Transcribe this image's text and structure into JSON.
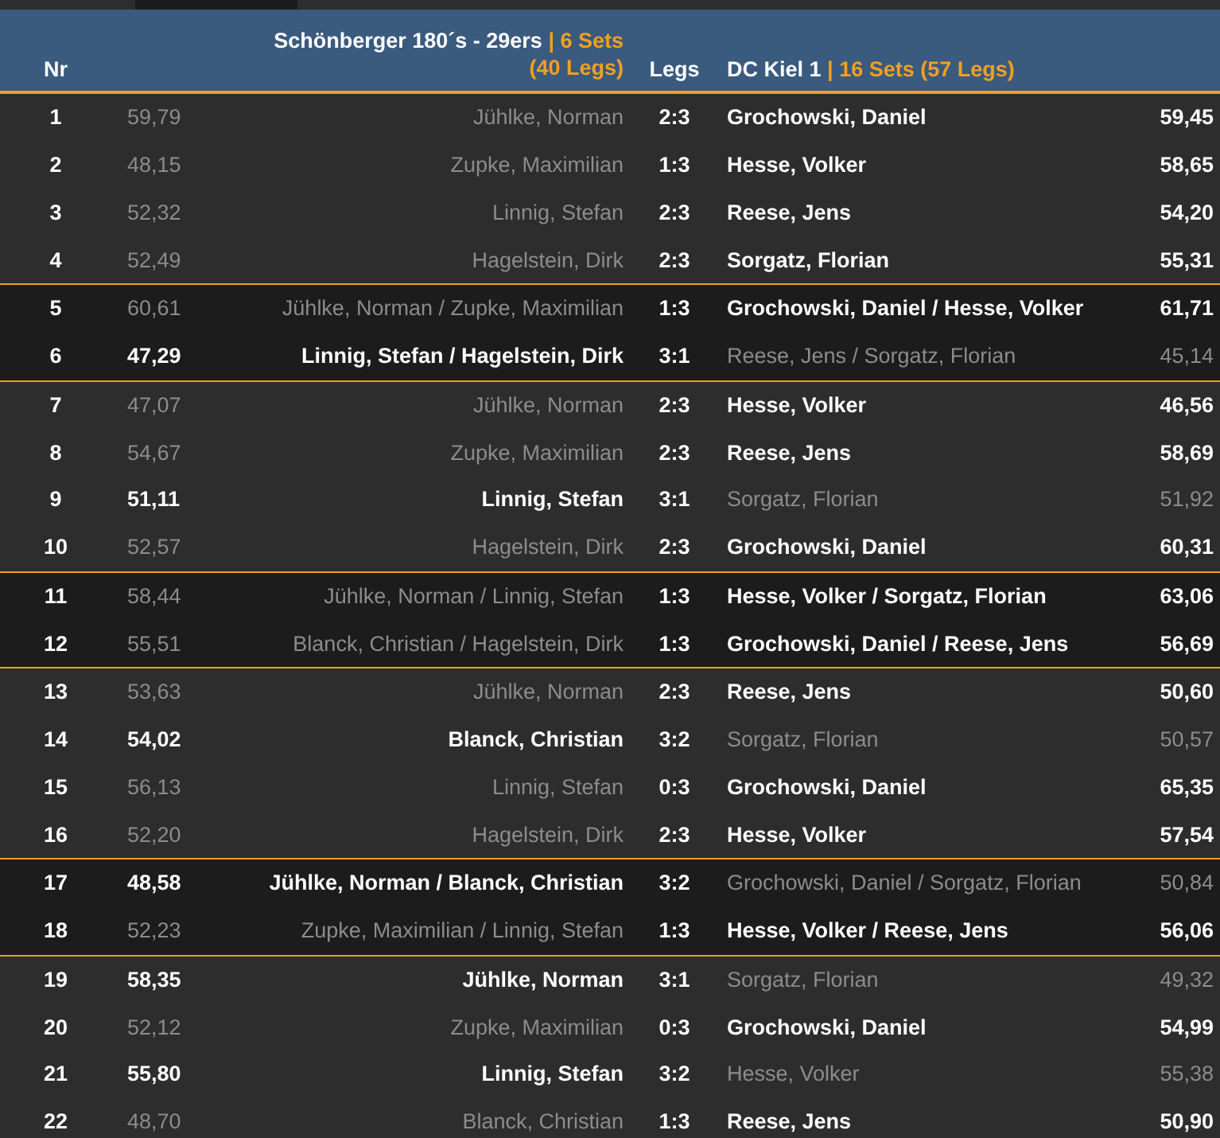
{
  "header": {
    "nr": "Nr",
    "home": {
      "team": "Schönberger 180´s - 29ers",
      "summary": "| 6 Sets (40 Legs)"
    },
    "legs": "Legs",
    "away": {
      "team": "DC Kiel 1",
      "summary": "| 16 Sets (57 Legs)"
    }
  },
  "rows": [
    {
      "nr": "1",
      "kind": "single",
      "home_avg": "59,79",
      "home": "Jühlke, Norman",
      "legs": "2:3",
      "away": "Grochowski, Daniel",
      "away_avg": "59,45",
      "home_won": false
    },
    {
      "nr": "2",
      "kind": "single",
      "home_avg": "48,15",
      "home": "Zupke, Maximilian",
      "legs": "1:3",
      "away": "Hesse, Volker",
      "away_avg": "58,65",
      "home_won": false
    },
    {
      "nr": "3",
      "kind": "single",
      "home_avg": "52,32",
      "home": "Linnig, Stefan",
      "legs": "2:3",
      "away": "Reese, Jens",
      "away_avg": "54,20",
      "home_won": false
    },
    {
      "nr": "4",
      "kind": "single",
      "home_avg": "52,49",
      "home": "Hagelstein, Dirk",
      "legs": "2:3",
      "away": "Sorgatz, Florian",
      "away_avg": "55,31",
      "home_won": false
    },
    {
      "nr": "5",
      "kind": "double",
      "home_avg": "60,61",
      "home": "Jühlke, Norman / Zupke, Maximilian",
      "legs": "1:3",
      "away": "Grochowski, Daniel / Hesse, Volker",
      "away_avg": "61,71",
      "home_won": false
    },
    {
      "nr": "6",
      "kind": "double",
      "home_avg": "47,29",
      "home": "Linnig, Stefan / Hagelstein, Dirk",
      "legs": "3:1",
      "away": "Reese, Jens / Sorgatz, Florian",
      "away_avg": "45,14",
      "home_won": true
    },
    {
      "nr": "7",
      "kind": "single",
      "home_avg": "47,07",
      "home": "Jühlke, Norman",
      "legs": "2:3",
      "away": "Hesse, Volker",
      "away_avg": "46,56",
      "home_won": false
    },
    {
      "nr": "8",
      "kind": "single",
      "home_avg": "54,67",
      "home": "Zupke, Maximilian",
      "legs": "2:3",
      "away": "Reese, Jens",
      "away_avg": "58,69",
      "home_won": false
    },
    {
      "nr": "9",
      "kind": "single",
      "home_avg": "51,11",
      "home": "Linnig, Stefan",
      "legs": "3:1",
      "away": "Sorgatz, Florian",
      "away_avg": "51,92",
      "home_won": true
    },
    {
      "nr": "10",
      "kind": "single",
      "home_avg": "52,57",
      "home": "Hagelstein, Dirk",
      "legs": "2:3",
      "away": "Grochowski, Daniel",
      "away_avg": "60,31",
      "home_won": false
    },
    {
      "nr": "11",
      "kind": "double",
      "home_avg": "58,44",
      "home": "Jühlke, Norman / Linnig, Stefan",
      "legs": "1:3",
      "away": "Hesse, Volker / Sorgatz, Florian",
      "away_avg": "63,06",
      "home_won": false
    },
    {
      "nr": "12",
      "kind": "double",
      "home_avg": "55,51",
      "home": "Blanck, Christian / Hagelstein, Dirk",
      "legs": "1:3",
      "away": "Grochowski, Daniel / Reese, Jens",
      "away_avg": "56,69",
      "home_won": false
    },
    {
      "nr": "13",
      "kind": "single",
      "home_avg": "53,63",
      "home": "Jühlke, Norman",
      "legs": "2:3",
      "away": "Reese, Jens",
      "away_avg": "50,60",
      "home_won": false
    },
    {
      "nr": "14",
      "kind": "single",
      "home_avg": "54,02",
      "home": "Blanck, Christian",
      "legs": "3:2",
      "away": "Sorgatz, Florian",
      "away_avg": "50,57",
      "home_won": true
    },
    {
      "nr": "15",
      "kind": "single",
      "home_avg": "56,13",
      "home": "Linnig, Stefan",
      "legs": "0:3",
      "away": "Grochowski, Daniel",
      "away_avg": "65,35",
      "home_won": false
    },
    {
      "nr": "16",
      "kind": "single",
      "home_avg": "52,20",
      "home": "Hagelstein, Dirk",
      "legs": "2:3",
      "away": "Hesse, Volker",
      "away_avg": "57,54",
      "home_won": false
    },
    {
      "nr": "17",
      "kind": "double",
      "home_avg": "48,58",
      "home": "Jühlke, Norman / Blanck, Christian",
      "legs": "3:2",
      "away": "Grochowski, Daniel / Sorgatz, Florian",
      "away_avg": "50,84",
      "home_won": true
    },
    {
      "nr": "18",
      "kind": "double",
      "home_avg": "52,23",
      "home": "Zupke, Maximilian / Linnig, Stefan",
      "legs": "1:3",
      "away": "Hesse, Volker / Reese, Jens",
      "away_avg": "56,06",
      "home_won": false
    },
    {
      "nr": "19",
      "kind": "single",
      "home_avg": "58,35",
      "home": "Jühlke, Norman",
      "legs": "3:1",
      "away": "Sorgatz, Florian",
      "away_avg": "49,32",
      "home_won": true
    },
    {
      "nr": "20",
      "kind": "single",
      "home_avg": "52,12",
      "home": "Zupke, Maximilian",
      "legs": "0:3",
      "away": "Grochowski, Daniel",
      "away_avg": "54,99",
      "home_won": false
    },
    {
      "nr": "21",
      "kind": "single",
      "home_avg": "55,80",
      "home": "Linnig, Stefan",
      "legs": "3:2",
      "away": "Hesse, Volker",
      "away_avg": "55,38",
      "home_won": true
    },
    {
      "nr": "22",
      "kind": "single",
      "home_avg": "48,70",
      "home": "Blanck, Christian",
      "legs": "1:3",
      "away": "Reese, Jens",
      "away_avg": "50,90",
      "home_won": false
    }
  ]
}
